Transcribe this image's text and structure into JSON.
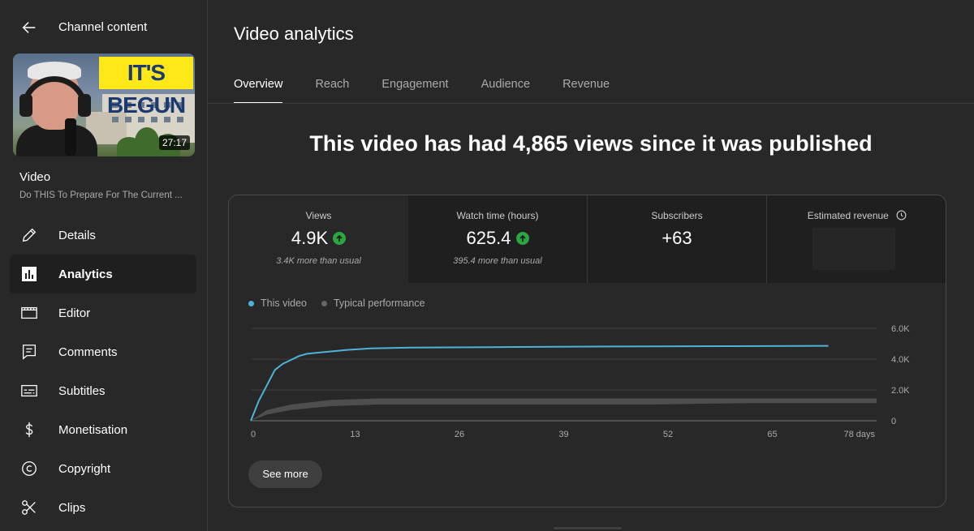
{
  "sidebar": {
    "header_title": "Channel content",
    "thumbnail_text": "IT'S BEGUN",
    "duration": "27:17",
    "video_label": "Video",
    "video_title": "Do THIS To Prepare For The Current ...",
    "items": [
      {
        "label": "Details",
        "icon": "pencil-icon",
        "active": false
      },
      {
        "label": "Analytics",
        "icon": "analytics-icon",
        "active": true
      },
      {
        "label": "Editor",
        "icon": "film-icon",
        "active": false
      },
      {
        "label": "Comments",
        "icon": "comment-icon",
        "active": false
      },
      {
        "label": "Subtitles",
        "icon": "subtitles-icon",
        "active": false
      },
      {
        "label": "Monetisation",
        "icon": "dollar-icon",
        "active": false
      },
      {
        "label": "Copyright",
        "icon": "copyright-icon",
        "active": false
      },
      {
        "label": "Clips",
        "icon": "scissors-icon",
        "active": false
      }
    ]
  },
  "main": {
    "title": "Video analytics",
    "tabs": [
      {
        "label": "Overview",
        "active": true
      },
      {
        "label": "Reach",
        "active": false
      },
      {
        "label": "Engagement",
        "active": false
      },
      {
        "label": "Audience",
        "active": false
      },
      {
        "label": "Revenue",
        "active": false
      }
    ],
    "headline": "This video has had 4,865 views since it was published",
    "metrics": [
      {
        "label": "Views",
        "value": "4.9K",
        "sub": "3.4K more than usual",
        "trend": "up"
      },
      {
        "label": "Watch time (hours)",
        "value": "625.4",
        "sub": "395.4 more than usual",
        "trend": "up"
      },
      {
        "label": "Subscribers",
        "value": "+63",
        "sub": "",
        "trend": ""
      },
      {
        "label": "Estimated revenue",
        "value": "",
        "sub": "",
        "trend": ""
      }
    ],
    "see_more": "See more"
  },
  "colors": {
    "this_video": "#4fb3d9",
    "typical": "#555555",
    "up_badge": "#2ba640"
  },
  "chart_data": {
    "type": "line",
    "x_tick_labels": [
      "0",
      "13",
      "26",
      "39",
      "52",
      "65",
      "78 days"
    ],
    "x_ticks": [
      0,
      13,
      26,
      39,
      52,
      65,
      78
    ],
    "y_tick_labels": [
      "6.0K",
      "4.0K",
      "2.0K",
      "0"
    ],
    "y_ticks": [
      6000,
      4000,
      2000,
      0
    ],
    "xlim": [
      0,
      78
    ],
    "ylim": [
      0,
      6000
    ],
    "legend": [
      "This video",
      "Typical performance"
    ],
    "series": [
      {
        "name": "This video",
        "x": [
          0,
          1,
          2,
          3,
          4,
          5,
          6,
          7,
          8,
          10,
          12,
          15,
          20,
          30,
          45,
          60,
          72
        ],
        "y": [
          0,
          1300,
          2300,
          3300,
          3700,
          3950,
          4200,
          4350,
          4400,
          4500,
          4600,
          4700,
          4750,
          4780,
          4820,
          4840,
          4865
        ]
      },
      {
        "name": "Typical performance",
        "type": "band",
        "x": [
          0,
          2,
          5,
          10,
          16,
          30,
          50,
          62,
          78
        ],
        "low": [
          0,
          400,
          700,
          950,
          1050,
          1050,
          1050,
          1150,
          1150
        ],
        "high": [
          0,
          700,
          1050,
          1350,
          1450,
          1450,
          1450,
          1450,
          1450
        ]
      }
    ]
  }
}
